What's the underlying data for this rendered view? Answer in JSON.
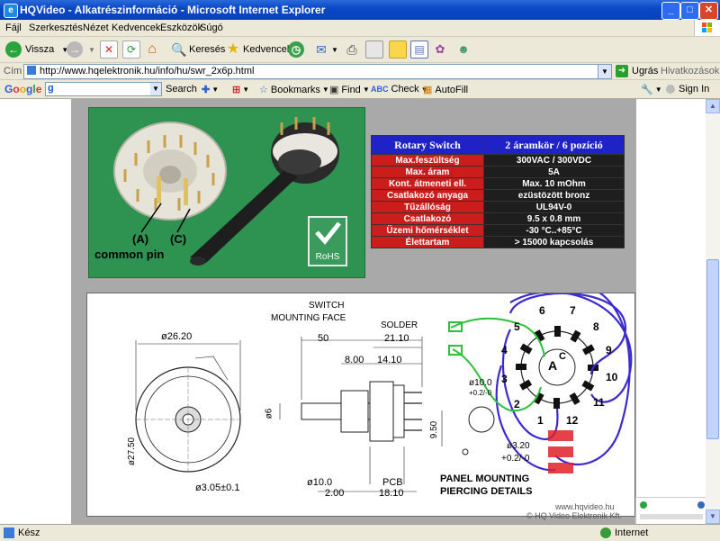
{
  "window": {
    "title": "HQVideo - Alkatrészinformáció - Microsoft Internet Explorer",
    "minimize": "_",
    "maximize": "□",
    "close": "✕"
  },
  "menu": [
    "Fájl",
    "Szerkesztés",
    "Nézet",
    "Kedvencek",
    "Eszközök",
    "Súgó"
  ],
  "toolbar": {
    "back_label": "Vissza",
    "search_label": "Keresés",
    "favorites_label": "Kedvencek"
  },
  "address": {
    "label": "Cím",
    "url": "http://www.hqelektronik.hu/info/hu/swr_2x6p.html",
    "go_label": "Ugrás",
    "links_label": "Hivatkozások"
  },
  "google_bar": {
    "logo": "Google",
    "search_label": "Search",
    "bookmarks_label": "Bookmarks",
    "find_label": "Find",
    "check_label": "Check",
    "autofill_label": "AutoFill",
    "signin_label": "Sign In"
  },
  "photo": {
    "label_a": "(A)",
    "label_c": "(C)",
    "common_pin": "common pin",
    "rohs": "RoHS"
  },
  "spec_table": {
    "title": "Rotary Switch",
    "subtitle": "2 áramkör / 6 pozíció",
    "rows": [
      {
        "name": "Max.feszültség",
        "value": "300VAC / 300VDC"
      },
      {
        "name": "Max. áram",
        "value": "5A"
      },
      {
        "name": "Kont. átmeneti ell.",
        "value": "Max. 10 mOhm"
      },
      {
        "name": "Csatlakozó anyaga",
        "value": "ezüstözött bronz"
      },
      {
        "name": "Tűzállóság",
        "value": "UL94V-0"
      },
      {
        "name": "Csatlakozó",
        "value": "9.5 x 0.8 mm"
      },
      {
        "name": "Üzemi hőmérséklet",
        "value": "-30 °C..+85°C"
      },
      {
        "name": "Élettartam",
        "value": "> 15000 kapcsolás"
      }
    ]
  },
  "drawing": {
    "switch_label": "SWITCH",
    "mounting_face": "MOUNTING FACE",
    "solder": "SOLDER",
    "dim_5000": "50",
    "dim_2110": "21.10",
    "dim_800": "8.00",
    "dim_1410": "14.10",
    "dim_2620": "ø26.20",
    "dim_2750": "ø27.50",
    "dim_305": "ø3.05±0.1",
    "dim_6": "ø6",
    "dim_10": "ø10.0",
    "dim_200": "2.00",
    "dim_1810": "18.10",
    "dim_950": "9.50",
    "pcb": "PCB",
    "panel_mounting": "PANEL MOUNTING",
    "piercing_details": "PIERCING DETAILS",
    "dim_100b": "ø10.0",
    "dim_100b_tol": "+0.2/-0",
    "dim_320": "ø3.20",
    "dim_320_tol": "+0.2/-0",
    "pins": [
      "1",
      "2",
      "3",
      "4",
      "5",
      "6",
      "7",
      "8",
      "9",
      "10",
      "11",
      "12"
    ],
    "center_a": "A",
    "center_c": "C",
    "footer_1": "www.hqvideo.hu",
    "footer_2": "© HQ Video Elektronik Kft."
  },
  "status": {
    "text": "Kész",
    "zone": "Internet"
  },
  "colors": {
    "title_blue": "#0a48c8",
    "spec_header": "#1f23c7",
    "spec_name": "#cc1d1d",
    "photo_green": "#2e9351",
    "wire_blue": "#3a2ad0",
    "wire_green": "#2bc23a",
    "resistor_red": "#e0202a"
  }
}
